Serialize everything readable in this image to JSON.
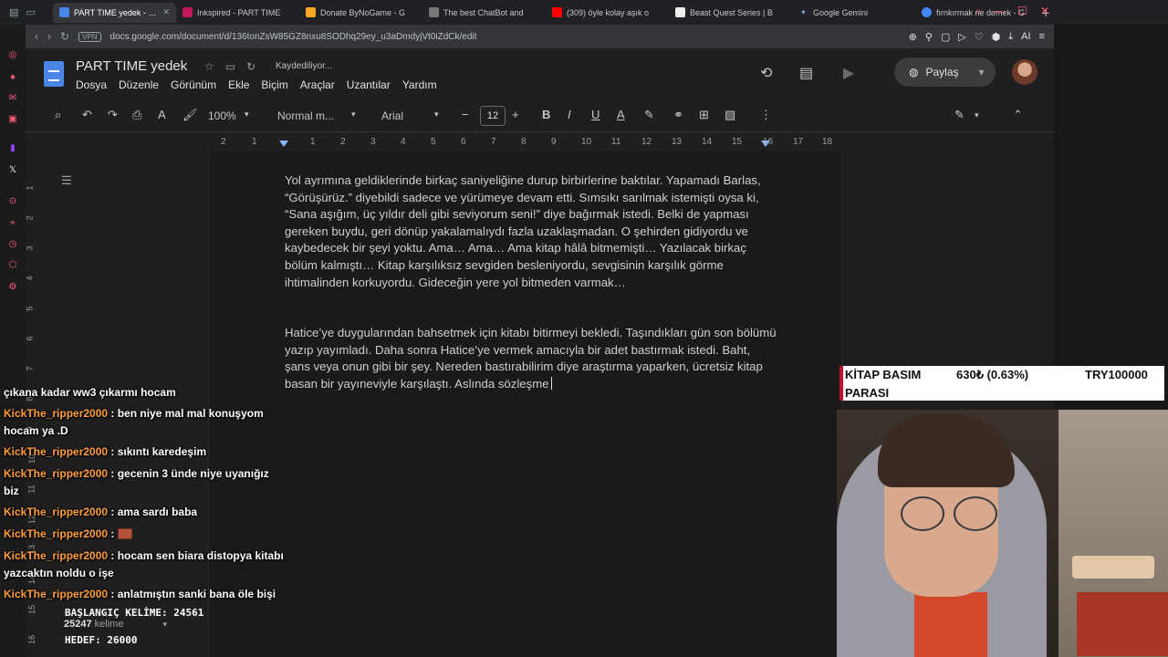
{
  "browser": {
    "tabs": [
      {
        "title": "PART TIME yedek - Google",
        "active": true,
        "fav_color": "#4a86e8"
      },
      {
        "title": "Inkspired - PART TIME",
        "active": false,
        "fav_color": "#c2185b"
      },
      {
        "title": "Donate ByNoGame - G",
        "active": false,
        "fav_color": "#f9a825"
      },
      {
        "title": "The best ChatBot and",
        "active": false,
        "fav_color": "#777777"
      },
      {
        "title": "(309) öyle kolay aşık o",
        "active": false,
        "fav_color": "#ff0000"
      },
      {
        "title": "Beast Quest Series | B",
        "active": false,
        "fav_color": "#eeeeee"
      },
      {
        "title": "Google Gemini",
        "active": false,
        "fav_color": "#8ab4f8"
      },
      {
        "title": "fırnkırmak ne demek - G",
        "active": false,
        "fav_color": "#4285f4"
      }
    ],
    "url": "docs.google.com/document/d/136tonZsW85GZ8nxu8SODhq29ey_u3aDmdyjVt0iZdCk/edit",
    "vpn_label": "VPN",
    "ai_label": "AI"
  },
  "docs": {
    "title": "PART TIME  yedek",
    "saving": "Kaydediliyor...",
    "menu": [
      "Dosya",
      "Düzenle",
      "Görünüm",
      "Ekle",
      "Biçim",
      "Araçlar",
      "Uzantılar",
      "Yardım"
    ],
    "share_label": "Paylaş",
    "zoom": "100%",
    "style": "Normal m...",
    "font": "Arial",
    "font_size": "12",
    "ruler_numbers": [
      "2",
      "1",
      "1",
      "2",
      "3",
      "4",
      "5",
      "6",
      "7",
      "8",
      "9",
      "10",
      "11",
      "12",
      "13",
      "14",
      "15",
      "16",
      "17",
      "18"
    ],
    "vruler_numbers": [
      "1",
      "2",
      "3",
      "4",
      "5",
      "6",
      "7",
      "8",
      "9",
      "10",
      "11",
      "12",
      "13",
      "14",
      "15",
      "16"
    ],
    "paragraph1": "Yol ayrımına geldiklerinde birkaç saniyeliğine durup birbirlerine baktılar. Yapamadı Barlas, “Görüşürüz.” diyebildi sadece ve yürümeye devam etti. Sımsıkı sarılmak istemişti oysa ki, “Sana aşığım, üç yıldır deli gibi seviyorum seni!” diye bağırmak istedi. Belki de yapması gereken buydu, geri dönüp yakalamalıydı fazla uzaklaşmadan. O şehirden gidiyordu ve kaybedecek bir şeyi yoktu. Ama… Ama… Ama kitap hâlâ bitmemişti… Yazılacak birkaç bölüm kalmıştı… Kitap karşılıksız sevgiden besleniyordu, sevgisinin karşılık görme ihtimalinden korkuyordu. Gideceğin yere yol bitmeden varmak…",
    "paragraph2": "Hatice’ye duygularından bahsetmek için kitabı bitirmeyi bekledi. Taşındıkları gün son bölümü yazıp yayımladı. Daha sonra Hatice’ye vermek amacıyla bir adet bastırmak istedi. Baht, şans veya onun gibi bir şey. Nereden bastırabilirim diye araştırma yaparken, ücretsiz kitap basan bir yayıneviyle karşılaştı. Aslında sözleşme",
    "word_count": "25247",
    "word_count_label": "kelime"
  },
  "chat": [
    {
      "user": "",
      "text": "çıkana kadar ww3 çıkarmı hocam"
    },
    {
      "user": "KickThe_ripper2000",
      "text": " : ben niye mal mal konuşyom hocam ya .D"
    },
    {
      "user": "KickThe_ripper2000",
      "text": " : sıkıntı karedeşim"
    },
    {
      "user": "KickThe_ripper2000",
      "text": " : gecenin 3 ünde niye uyanığız biz"
    },
    {
      "user": "KickThe_ripper2000",
      "text": " : ama sardı baba"
    },
    {
      "user": "KickThe_ripper2000",
      "text": " : ",
      "emote": true
    },
    {
      "user": "KickThe_ripper2000",
      "text": " : hocam sen biara distopya kitabı yazcaktın noldu o işe"
    },
    {
      "user": "KickThe_ripper2000",
      "text": " : anlatmıştın sanki bana öle bişi"
    }
  ],
  "counter": {
    "start": "BAŞLANGIÇ KELİME: 24561",
    "target": "HEDEF: 26000"
  },
  "donation": {
    "title_line1": "KİTAP BASIM",
    "title_line2": "PARASI",
    "amount": "630₺ (0.63%)",
    "goal": "TRY100000"
  }
}
